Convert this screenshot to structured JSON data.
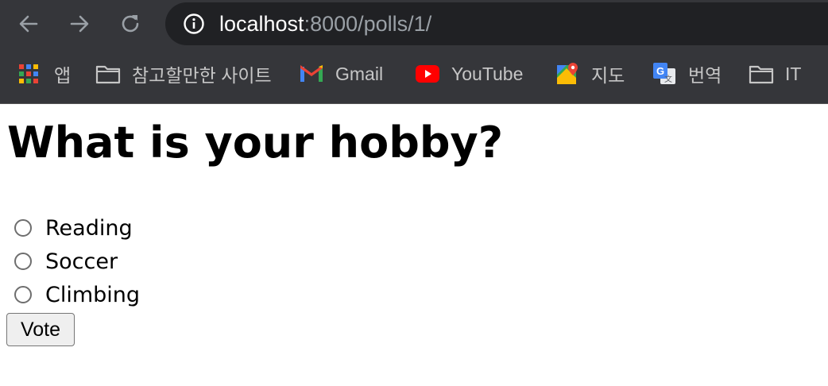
{
  "browser": {
    "url_host": "localhost",
    "url_path": ":8000/polls/1/",
    "bookmarks": [
      {
        "label": "앱",
        "icon": "apps-grid-icon"
      },
      {
        "label": "참고할만한 사이트",
        "icon": "folder-icon"
      },
      {
        "label": "Gmail",
        "icon": "gmail-icon"
      },
      {
        "label": "YouTube",
        "icon": "youtube-icon"
      },
      {
        "label": "지도",
        "icon": "maps-icon"
      },
      {
        "label": "번역",
        "icon": "translate-icon"
      },
      {
        "label": "IT",
        "icon": "folder-icon"
      }
    ]
  },
  "poll": {
    "question": "What is your hobby?",
    "choices": [
      {
        "label": "Reading",
        "selected": false
      },
      {
        "label": "Soccer",
        "selected": false
      },
      {
        "label": "Climbing",
        "selected": false
      }
    ],
    "submit_label": "Vote"
  },
  "colors": {
    "chrome_bg": "#35363a",
    "omnibox_bg": "#202124",
    "youtube_red": "#ff0000",
    "gmail_red": "#ea4335"
  }
}
